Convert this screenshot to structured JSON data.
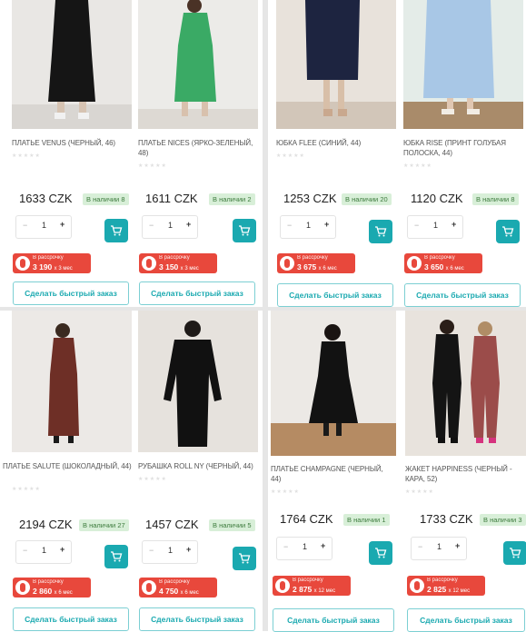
{
  "colors": {
    "accent": "#1aa9b0",
    "installment": "#e8483c",
    "stock_bg": "#d8efd8",
    "stock_text": "#3c7a3c"
  },
  "icons": {
    "cart": "shopping-cart-icon",
    "installment": "installment-logo-icon"
  },
  "products": [
    {
      "name": "ПЛАТЬЕ VENUS (ЧЕРНЫЙ, 46)",
      "price": "1633 CZK",
      "stock": "В наличии 8",
      "qty_minus": "−",
      "qty": "1",
      "qty_plus": "+",
      "installment_label": "В рассрочку",
      "installment_amount": "3 190",
      "installment_term": "х 3 мес",
      "quick_order": "Сделать быстрый заказ"
    },
    {
      "name": "ПЛАТЬЕ NICES (ЯРКО-ЗЕЛЕНЫЙ, 48)",
      "price": "1611 CZK",
      "stock": "В наличии 2",
      "qty_minus": "−",
      "qty": "1",
      "qty_plus": "+",
      "installment_label": "В рассрочку",
      "installment_amount": "3 150",
      "installment_term": "х 3 мес",
      "quick_order": "Сделать быстрый заказ"
    },
    {
      "name": "ЮБКА FLEE (СИНИЙ, 44)",
      "price": "1253 CZK",
      "stock": "В наличии 20",
      "qty_minus": "−",
      "qty": "1",
      "qty_plus": "+",
      "installment_label": "В рассрочку",
      "installment_amount": "3 675",
      "installment_term": "х 6 мес",
      "quick_order": "Сделать быстрый заказ"
    },
    {
      "name": "ЮБКА RISE (ПРИНТ ГОЛУБАЯ ПОЛОСКА, 44)",
      "price": "1120 CZK",
      "stock": "В наличии 8",
      "qty_minus": "−",
      "qty": "1",
      "qty_plus": "+",
      "installment_label": "В рассрочку",
      "installment_amount": "3 650",
      "installment_term": "х 6 мес",
      "quick_order": "Сделать быстрый заказ"
    },
    {
      "name": "ПЛАТЬЕ SALUTE (ШОКОЛАДНЫЙ, 44)",
      "price": "2194 CZK",
      "stock": "В наличии 27",
      "qty_minus": "−",
      "qty": "1",
      "qty_plus": "+",
      "installment_label": "В рассрочку",
      "installment_amount": "2 860",
      "installment_term": "х 6 мес",
      "quick_order": "Сделать быстрый заказ"
    },
    {
      "name": "РУБАШКА ROLL NY (ЧЕРНЫЙ, 44)",
      "price": "1457 CZK",
      "stock": "В наличии 5",
      "qty_minus": "−",
      "qty": "1",
      "qty_plus": "+",
      "installment_label": "В рассрочку",
      "installment_amount": "4 750",
      "installment_term": "х 6 мес",
      "quick_order": "Сделать быстрый заказ"
    },
    {
      "name": "ПЛАТЬЕ CHAMPAGNE (ЧЕРНЫЙ, 44)",
      "price": "1764 CZK",
      "stock": "В наличии 1",
      "qty_minus": "−",
      "qty": "1",
      "qty_plus": "+",
      "installment_label": "В рассрочку",
      "installment_amount": "2 875",
      "installment_term": "х 12 мес",
      "quick_order": "Сделать быстрый заказ"
    },
    {
      "name": "ЖАКЕТ HAPPINESS (ЧЕРНЫЙ - КАРА, 52)",
      "price": "1733 CZK",
      "stock": "В наличии 3",
      "qty_minus": "−",
      "qty": "1",
      "qty_plus": "+",
      "installment_label": "В рассрочку",
      "installment_amount": "2 825",
      "installment_term": "х 12 мес",
      "quick_order": "Сделать быстрый заказ"
    }
  ]
}
